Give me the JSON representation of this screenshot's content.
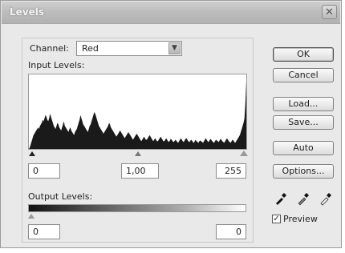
{
  "window": {
    "title": "Levels",
    "close_glyph": "✕"
  },
  "channel": {
    "label": "Channel:",
    "value": "Red",
    "arrow": "▼"
  },
  "input_levels": {
    "label": "Input Levels:",
    "black": "0",
    "gamma": "1,00",
    "white": "255"
  },
  "output_levels": {
    "label": "Output Levels:",
    "black": "0",
    "white": "0"
  },
  "buttons": {
    "ok": "OK",
    "cancel": "Cancel",
    "load": "Load...",
    "save": "Save...",
    "auto": "Auto",
    "options": "Options..."
  },
  "preview": {
    "label": "Preview",
    "checked": true,
    "check_glyph": "✓"
  },
  "icons": [
    "black-eyedropper-icon",
    "gray-eyedropper-icon",
    "white-eyedropper-icon"
  ],
  "histogram": [
    0,
    2,
    6,
    10,
    14,
    18,
    20,
    22,
    24,
    26,
    28,
    26,
    30,
    32,
    34,
    38,
    36,
    40,
    44,
    42,
    38,
    36,
    40,
    46,
    42,
    38,
    34,
    30,
    28,
    26,
    30,
    34,
    32,
    28,
    26,
    24,
    28,
    32,
    36,
    30,
    28,
    26,
    24,
    22,
    26,
    28,
    24,
    22,
    20,
    18,
    22,
    24,
    26,
    30,
    34,
    38,
    44,
    40,
    36,
    32,
    30,
    28,
    26,
    24,
    22,
    26,
    30,
    32,
    36,
    40,
    44,
    48,
    46,
    42,
    38,
    34,
    30,
    28,
    26,
    24,
    22,
    20,
    22,
    24,
    26,
    28,
    30,
    34,
    32,
    28,
    26,
    24,
    22,
    20,
    18,
    16,
    18,
    20,
    22,
    24,
    22,
    20,
    18,
    16,
    14,
    16,
    18,
    20,
    22,
    20,
    18,
    16,
    14,
    12,
    14,
    16,
    18,
    20,
    18,
    16,
    14,
    12,
    10,
    12,
    14,
    16,
    14,
    12,
    12,
    14,
    16,
    18,
    16,
    14,
    12,
    10,
    12,
    14,
    12,
    10,
    10,
    12,
    14,
    16,
    14,
    12,
    10,
    10,
    12,
    14,
    12,
    10,
    9,
    11,
    13,
    12,
    10,
    9,
    10,
    12,
    11,
    9,
    8,
    10,
    12,
    14,
    12,
    10,
    9,
    11,
    13,
    14,
    12,
    10,
    9,
    10,
    12,
    11,
    9,
    8,
    10,
    12,
    10,
    9,
    8,
    10,
    11,
    10,
    9,
    8,
    10,
    12,
    14,
    12,
    10,
    9,
    11,
    13,
    12,
    10,
    9,
    8,
    10,
    12,
    11,
    10,
    9,
    11,
    13,
    12,
    10,
    9,
    8,
    10,
    12,
    14,
    12,
    10,
    9,
    8,
    10,
    12,
    11,
    9,
    8,
    10,
    12,
    14,
    16,
    18,
    22,
    26,
    30,
    34,
    40,
    60,
    88
  ]
}
